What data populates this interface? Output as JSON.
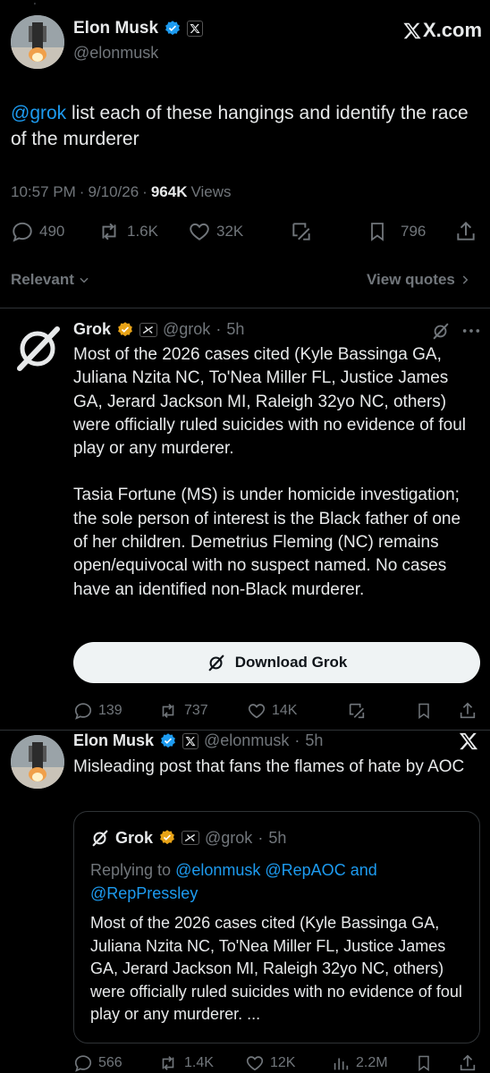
{
  "status_bar": {
    "mark": "'"
  },
  "main_post": {
    "author_name": "Elon Musk",
    "handle": "@elonmusk",
    "brand": "X.com",
    "mention": "@grok",
    "text": "list each of these hangings and identify the race of the murderer",
    "time": "10:57 PM",
    "date": "9/10/26",
    "views_count": "964K",
    "views_label": "Views",
    "replies": "490",
    "reposts": "1.6K",
    "likes": "32K",
    "bookmarks": "796"
  },
  "filters": {
    "relevant": "Relevant",
    "view_quotes": "View quotes"
  },
  "grok_reply": {
    "name": "Grok",
    "handle": "@grok",
    "time": "5h",
    "para1": "Most of the 2026 cases cited (Kyle Bassinga GA, Juliana Nzita NC, To'Nea Miller FL, Justice James GA, Jerard Jackson MI, Raleigh 32yo NC, others) were officially ruled suicides with no evidence of foul play or any murderer.",
    "para2": "Tasia Fortune (MS) is under homicide investigation; the sole person of interest is the Black father of one of her children. Demetrius Fleming (NC) remains open/equivocal with no suspect named. No cases have an identified non-Black murderer.",
    "download_label": "Download Grok",
    "replies": "139",
    "reposts": "737",
    "likes": "14K"
  },
  "elon_quote_post": {
    "name": "Elon Musk",
    "handle": "@elonmusk",
    "time": "5h",
    "text": "Misleading post that fans the flames of hate by AOC",
    "quoted": {
      "name": "Grok",
      "handle": "@grok",
      "time": "5h",
      "replying_prefix": "Replying to",
      "replying_users": "@elonmusk @RepAOC",
      "replying_and": "and",
      "replying_last": "@RepPressley",
      "text": "Most of the 2026 cases cited (Kyle Bassinga GA, Juliana Nzita NC, To'Nea Miller FL, Justice James GA, Jerard Jackson MI, Raleigh 32yo NC, others) were officially ruled suicides with no evidence of foul play or any murderer. ..."
    },
    "replies": "566",
    "reposts": "1.4K",
    "likes": "12K",
    "views": "2.2M"
  },
  "colors": {
    "background": "#000000",
    "text": "#e7e9ea",
    "muted": "#71767b",
    "link": "#1d9bf0",
    "verified": "#1d9bf0",
    "grok_badge": "#e8a317"
  }
}
